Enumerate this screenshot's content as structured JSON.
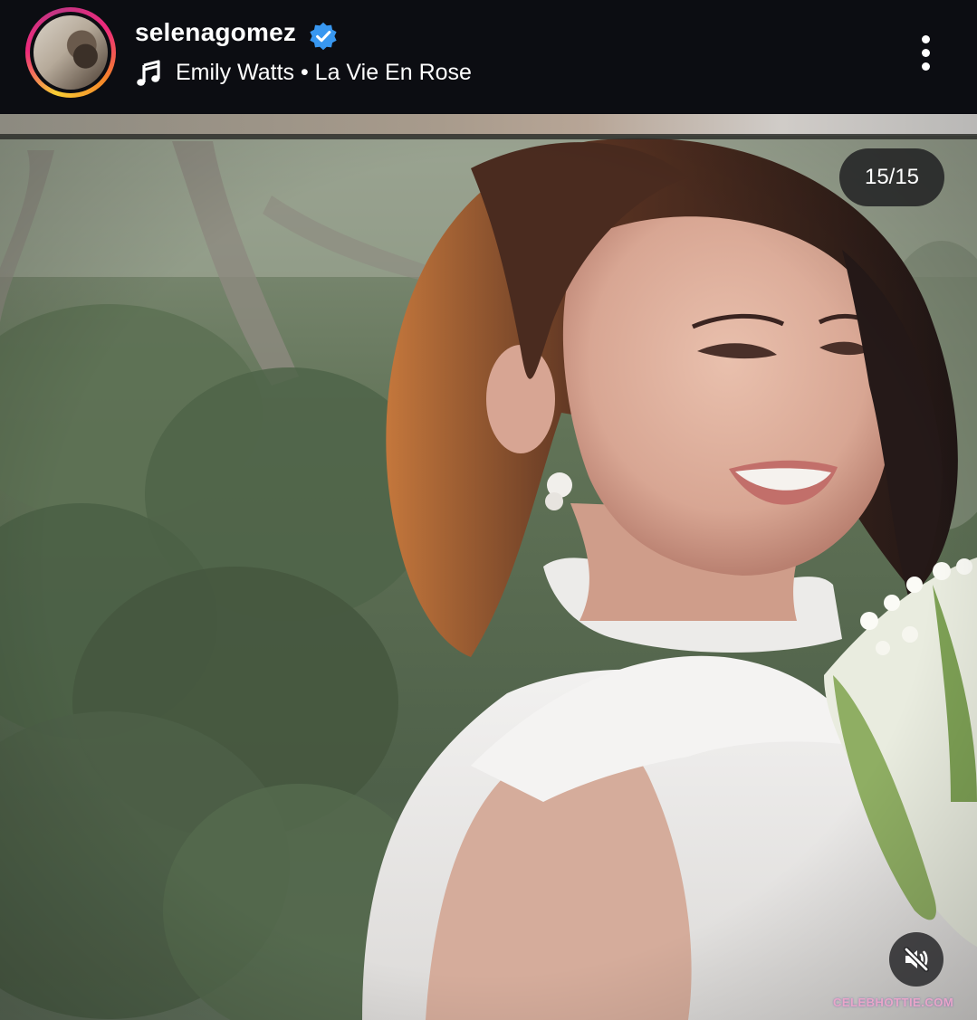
{
  "header": {
    "username": "selenagomez",
    "verified_icon": "verified-badge-icon",
    "music_icon": "music-note-icon",
    "audio_track": "Emily Watts • La Vie En Rose",
    "more_icon": "more-vertical-icon"
  },
  "post": {
    "slide_counter": "15/15",
    "mute_icon": "speaker-muted-icon",
    "watermark": "CELEBHOTTIE.COM"
  },
  "colors": {
    "background": "#0c0d12",
    "verified_blue": "#3897f0",
    "story_ring": [
      "#f9ce34",
      "#ee2a7b",
      "#c13584",
      "#f58529"
    ]
  }
}
